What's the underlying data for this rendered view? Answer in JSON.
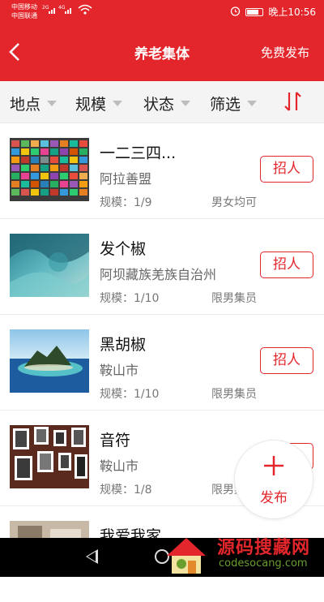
{
  "status_bar": {
    "carrier_1": "中国移动",
    "carrier_2": "中国联通",
    "signal_1": "2G",
    "signal_2": "4G",
    "time": "晚上10:56",
    "icons": [
      "alarm-icon",
      "battery-icon",
      "wifi-icon",
      "signal-icon"
    ]
  },
  "header": {
    "title": "养老集体",
    "back_icon": "chevron-left-icon",
    "publish_label": "免费发布",
    "background_color": "#e3262b"
  },
  "filters": {
    "items": [
      {
        "label": "地点"
      },
      {
        "label": "规模"
      },
      {
        "label": "状态"
      },
      {
        "label": "筛选"
      }
    ],
    "sort_icon": "sort-icon"
  },
  "list": {
    "recruit_label": "招人",
    "items": [
      {
        "title": "一二三四...",
        "region": "阿拉善盟",
        "scale": "规模：1/9",
        "gender": "男女均可",
        "thumb": "color-grid"
      },
      {
        "title": "发个椒",
        "region": "阿坝藏族羌族自治州",
        "scale": "规模：1/10",
        "gender": "限男集员",
        "thumb": "teal-abstract"
      },
      {
        "title": "黑胡椒",
        "region": "鞍山市",
        "scale": "规模：1/10",
        "gender": "限男集员",
        "thumb": "island"
      },
      {
        "title": "音符",
        "region": "鞍山市",
        "scale": "规模：1/8",
        "gender": "限男集员",
        "thumb": "photo-wall"
      },
      {
        "title": "我爱我家",
        "region": "",
        "scale": "",
        "gender": "",
        "thumb": "room"
      }
    ]
  },
  "fab": {
    "icon": "plus-icon",
    "label": "发布"
  },
  "watermark": {
    "text": "源码搜藏网",
    "sub": "codesocang.com"
  }
}
